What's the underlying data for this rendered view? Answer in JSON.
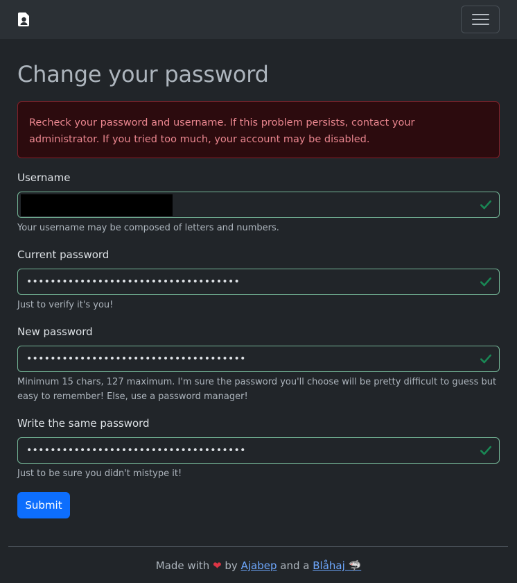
{
  "navbar": {
    "brand_icon": "file-person-icon",
    "menu_icon": "hamburger-menu-icon"
  },
  "page": {
    "title": "Change your password"
  },
  "alert": {
    "message": "Recheck your password and username. If this problem persists, contact your administrator. If you tried too much, your account may be disabled."
  },
  "form": {
    "username": {
      "label": "Username",
      "value": "",
      "help": "Your username may be composed of letters and numbers."
    },
    "current_password": {
      "label": "Current password",
      "value": "••••••••••••••••••••••••••••••••••••",
      "help": "Just to verify it's you!"
    },
    "new_password": {
      "label": "New password",
      "value": "•••••••••••••••••••••••••••••••••••••",
      "help": "Minimum 15 chars, 127 maximum. I'm sure the password you'll choose will be pretty difficult to guess but easy to remember! Else, use a password manager!"
    },
    "confirm_password": {
      "label": "Write the same password",
      "value": "•••••••••••••••••••••••••••••••••••••",
      "help": "Just to be sure you didn't mistype it!"
    },
    "submit_label": "Submit",
    "valid_icon": "check-icon"
  },
  "footer": {
    "made_with": "Made with",
    "heart": "❤",
    "by": "by",
    "author": "Ajabep",
    "and_a": "and a",
    "blahaj": "Blåhaj 🦈"
  },
  "colors": {
    "background": "#212529",
    "navbar": "#2b3035",
    "alert_bg": "#2c0b0e",
    "alert_border": "#842029",
    "alert_text": "#ea868f",
    "valid_border": "#75b798",
    "valid_icon": "#198754",
    "primary": "#0d6efd",
    "link": "#6ea8fe"
  }
}
